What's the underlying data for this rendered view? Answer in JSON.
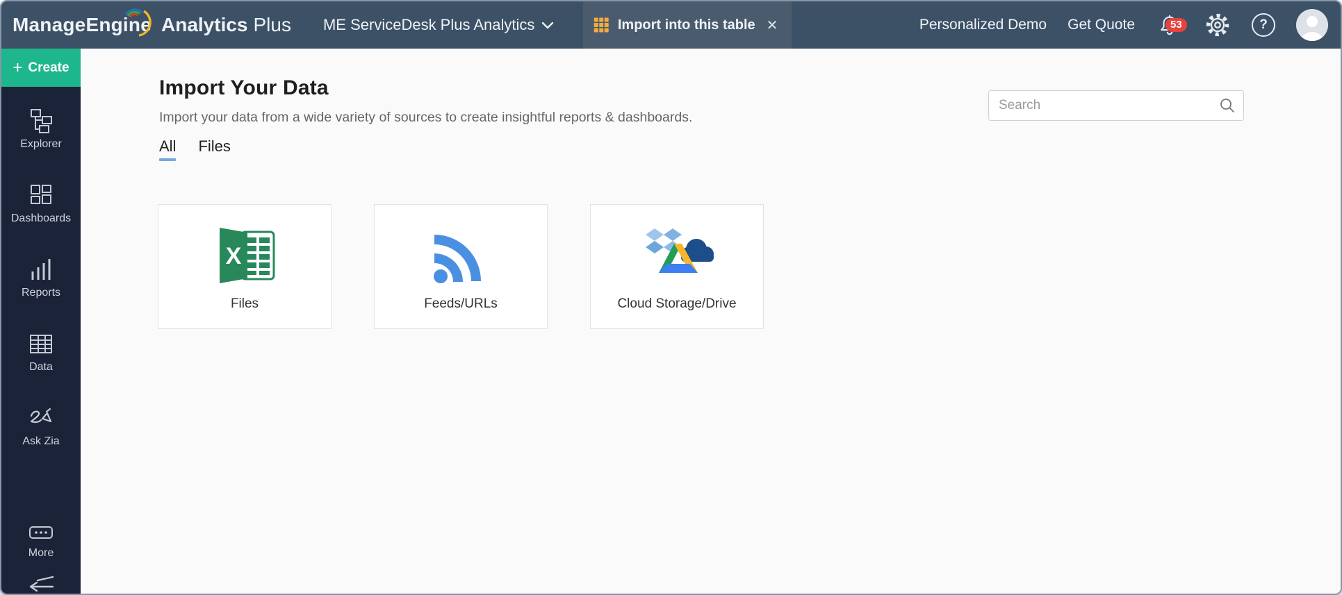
{
  "topbar": {
    "brand": {
      "part1": "ManageEngin",
      "part1e": "e",
      "part2": "Analytics",
      "part3": "Plus"
    },
    "workspace_name": "ME ServiceDesk Plus Analytics",
    "tab_label": "Import into this table",
    "close_glyph": "✕",
    "personalized_demo": "Personalized Demo",
    "get_quote": "Get Quote",
    "notification_count": "53",
    "help_glyph": "?"
  },
  "sidebar": {
    "create": {
      "plus": "+",
      "label": "Create"
    },
    "items": [
      {
        "label": "Explorer"
      },
      {
        "label": "Dashboards"
      },
      {
        "label": "Reports"
      },
      {
        "label": "Data"
      },
      {
        "label": "Ask Zia"
      },
      {
        "label": "More"
      }
    ]
  },
  "main": {
    "title": "Import Your Data",
    "subtitle": "Import your data from a wide variety of sources to create insightful reports & dashboards.",
    "search": {
      "placeholder": "Search"
    },
    "tabs": [
      {
        "label": "All"
      },
      {
        "label": "Files"
      }
    ],
    "cards": [
      {
        "label": "Files"
      },
      {
        "label": "Feeds/URLs"
      },
      {
        "label": "Cloud Storage/Drive"
      }
    ],
    "excel_letter": "X"
  },
  "colors": {
    "topbar_bg": "#3d5166",
    "tab_bg": "#4a5b6d",
    "sidebar_bg": "#1b2338",
    "create_bg": "#1eb68d",
    "accent_underline": "#74a9da",
    "badge_red": "#e5433f",
    "rss_blue": "#4a90e2",
    "excel_green": "#28885a"
  }
}
